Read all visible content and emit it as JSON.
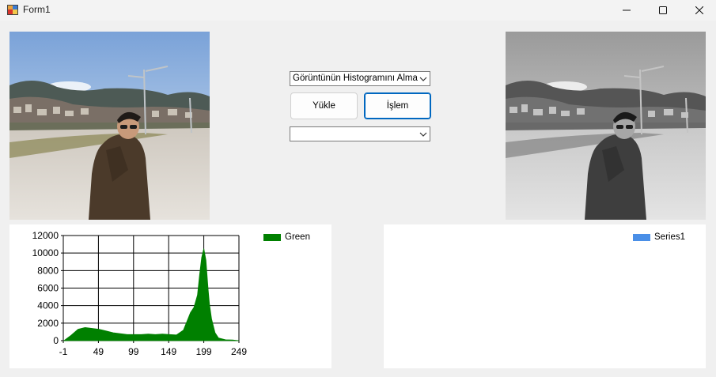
{
  "window": {
    "title": "Form1",
    "controls": [
      "minimize",
      "maximize",
      "close"
    ]
  },
  "toolbar": {
    "operation_select": {
      "value": "Görüntünün Histogramını Alma"
    },
    "load_button": "Yükle",
    "process_button": "İşlem",
    "secondary_select": {
      "value": ""
    }
  },
  "images": {
    "original": {
      "description": "color"
    },
    "processed": {
      "description": "grayscale"
    }
  },
  "left_chart_legend": "Green",
  "right_chart_legend": "Series1",
  "colors": {
    "green_series": "#008000",
    "series1": "#4a8fe7",
    "focus_border": "#0067c0"
  },
  "chart_data": [
    {
      "type": "area",
      "x_tick_labels": [
        "-1",
        "49",
        "99",
        "149",
        "199",
        "249"
      ],
      "y_tick_labels": [
        "0",
        "2000",
        "4000",
        "6000",
        "8000",
        "10000",
        "12000"
      ],
      "xlim": [
        -1,
        249
      ],
      "ylim": [
        0,
        12000
      ],
      "grid": true,
      "legend_placement": "top-right",
      "series": [
        {
          "name": "Green",
          "x": [
            0,
            10,
            20,
            30,
            40,
            50,
            60,
            70,
            80,
            90,
            100,
            110,
            120,
            130,
            140,
            150,
            160,
            170,
            175,
            180,
            185,
            190,
            193,
            196,
            199,
            202,
            205,
            207,
            210,
            215,
            220,
            230,
            240,
            249
          ],
          "y": [
            0,
            600,
            1300,
            1500,
            1400,
            1300,
            1100,
            900,
            800,
            700,
            700,
            700,
            750,
            700,
            750,
            700,
            650,
            1200,
            2200,
            3200,
            3800,
            5200,
            7500,
            9500,
            10500,
            9200,
            6000,
            4200,
            2500,
            900,
            300,
            100,
            80,
            0
          ]
        }
      ]
    },
    {
      "type": "bar",
      "series": [
        {
          "name": "Series1",
          "values": []
        }
      ],
      "legend_placement": "top-right"
    }
  ]
}
